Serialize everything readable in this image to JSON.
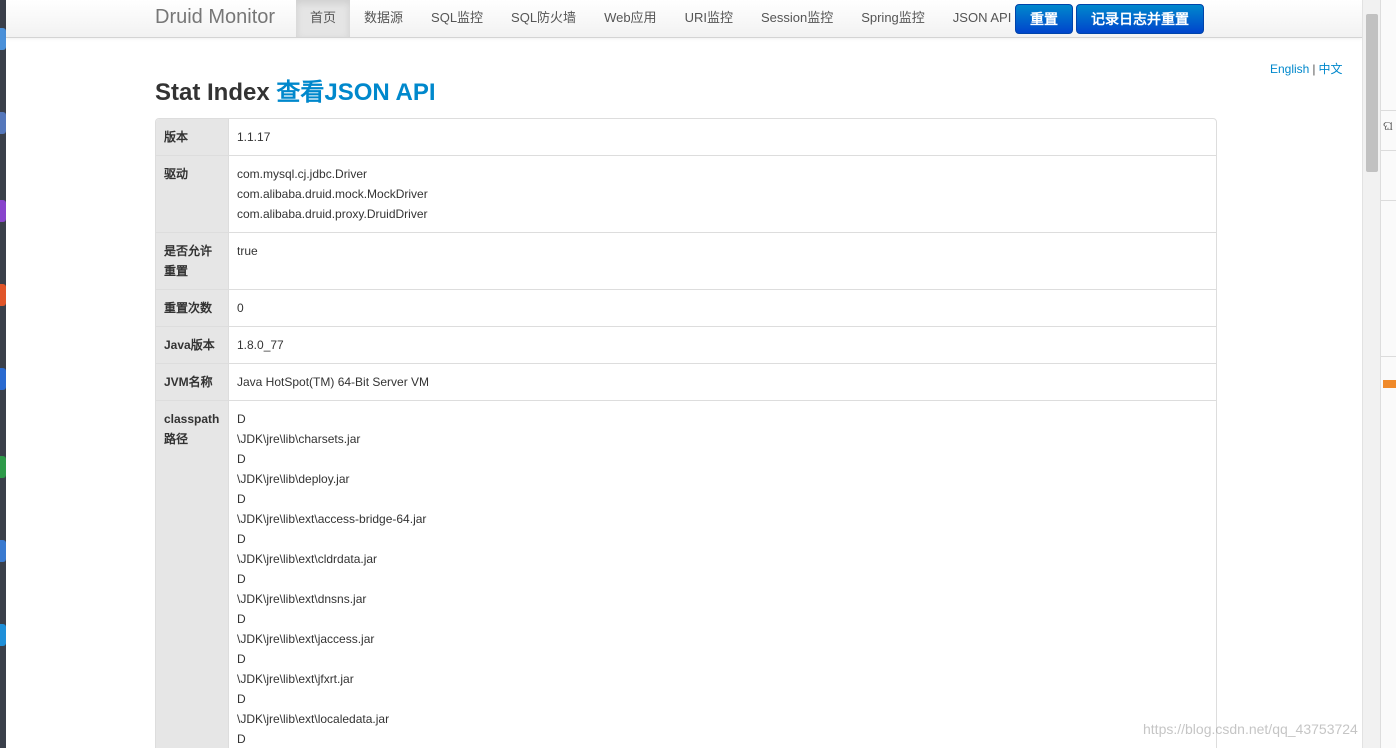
{
  "navbar": {
    "brand": "Druid Monitor",
    "items": [
      {
        "label": "首页",
        "active": true
      },
      {
        "label": "数据源",
        "active": false
      },
      {
        "label": "SQL监控",
        "active": false
      },
      {
        "label": "SQL防火墙",
        "active": false
      },
      {
        "label": "Web应用",
        "active": false
      },
      {
        "label": "URI监控",
        "active": false
      },
      {
        "label": "Session监控",
        "active": false
      },
      {
        "label": "Spring监控",
        "active": false
      },
      {
        "label": "JSON API",
        "active": false
      }
    ],
    "reset_label": "重置",
    "log_reset_label": "记录日志并重置"
  },
  "lang": {
    "english": "English",
    "separator": "|",
    "chinese": "中文"
  },
  "page": {
    "title": "Stat Index",
    "title_link": "查看JSON API"
  },
  "stats": [
    {
      "label": "版本",
      "values": [
        "1.1.17"
      ]
    },
    {
      "label": "驱动",
      "values": [
        "com.mysql.cj.jdbc.Driver",
        "com.alibaba.druid.mock.MockDriver",
        "com.alibaba.druid.proxy.DruidDriver"
      ]
    },
    {
      "label": "是否允许重置",
      "values": [
        "true"
      ]
    },
    {
      "label": "重置次数",
      "values": [
        "0"
      ]
    },
    {
      "label": "Java版本",
      "values": [
        "1.8.0_77"
      ]
    },
    {
      "label": "JVM名称",
      "values": [
        "Java HotSpot(TM) 64-Bit Server VM"
      ]
    },
    {
      "label": "classpath路径",
      "values": [
        "D",
        "\\JDK\\jre\\lib\\charsets.jar",
        "D",
        "\\JDK\\jre\\lib\\deploy.jar",
        "D",
        "\\JDK\\jre\\lib\\ext\\access-bridge-64.jar",
        "D",
        "\\JDK\\jre\\lib\\ext\\cldrdata.jar",
        "D",
        "\\JDK\\jre\\lib\\ext\\dnsns.jar",
        "D",
        "\\JDK\\jre\\lib\\ext\\jaccess.jar",
        "D",
        "\\JDK\\jre\\lib\\ext\\jfxrt.jar",
        "D",
        "\\JDK\\jre\\lib\\ext\\localedata.jar",
        "D"
      ]
    }
  ],
  "watermark": "https://blog.csdn.net/qq_43753724",
  "colors": {
    "accent": "#0088cc",
    "button": "#0055cc",
    "label_bg": "#e6e6e6"
  }
}
